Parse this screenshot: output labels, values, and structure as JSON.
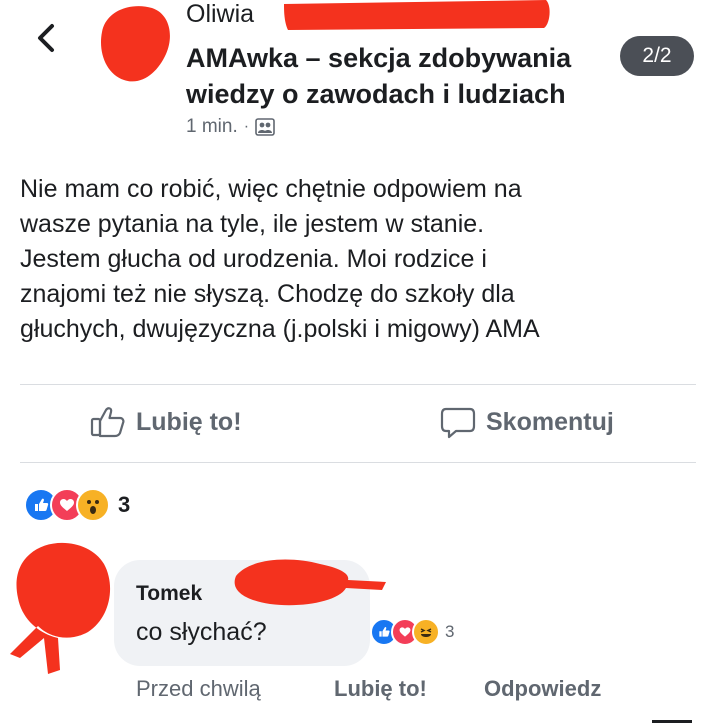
{
  "post": {
    "author": "Oliwia",
    "group": "AMAwka – sekcja zdobywania wiedzy o zawodach i ludziach",
    "counter": "2/2",
    "time": "1 min.",
    "separator": "·",
    "audience_icon": "group-audience-icon",
    "text": "Nie mam co robić, więc chętnie odpowiem na\nwasze pytania na tyle, ile jestem w stanie.\nJestem głucha od urodzenia. Moi rodzice i\nznajomi też nie słyszą. Chodzę do szkoły dla\ngłuchych, dwujęzyczna (j.polski i migowy) AMA"
  },
  "actions": {
    "like_label": "Lubię to!",
    "comment_label": "Skomentuj"
  },
  "reactions": {
    "types": [
      "like",
      "love",
      "wow"
    ],
    "count": "3"
  },
  "comment": {
    "author": "Tomek",
    "text": "co słychać?",
    "reactions": [
      "like",
      "love",
      "haha"
    ],
    "reaction_count": "3",
    "time": "Przed chwilą",
    "like_label": "Lubię to!",
    "reply_label": "Odpowiedz"
  },
  "colors": {
    "like_blue": "#1877f2",
    "love_red": "#f33e58",
    "emoji_yellow": "#f7b125",
    "redaction_red": "#f4321e",
    "secondary_text": "#606770"
  }
}
